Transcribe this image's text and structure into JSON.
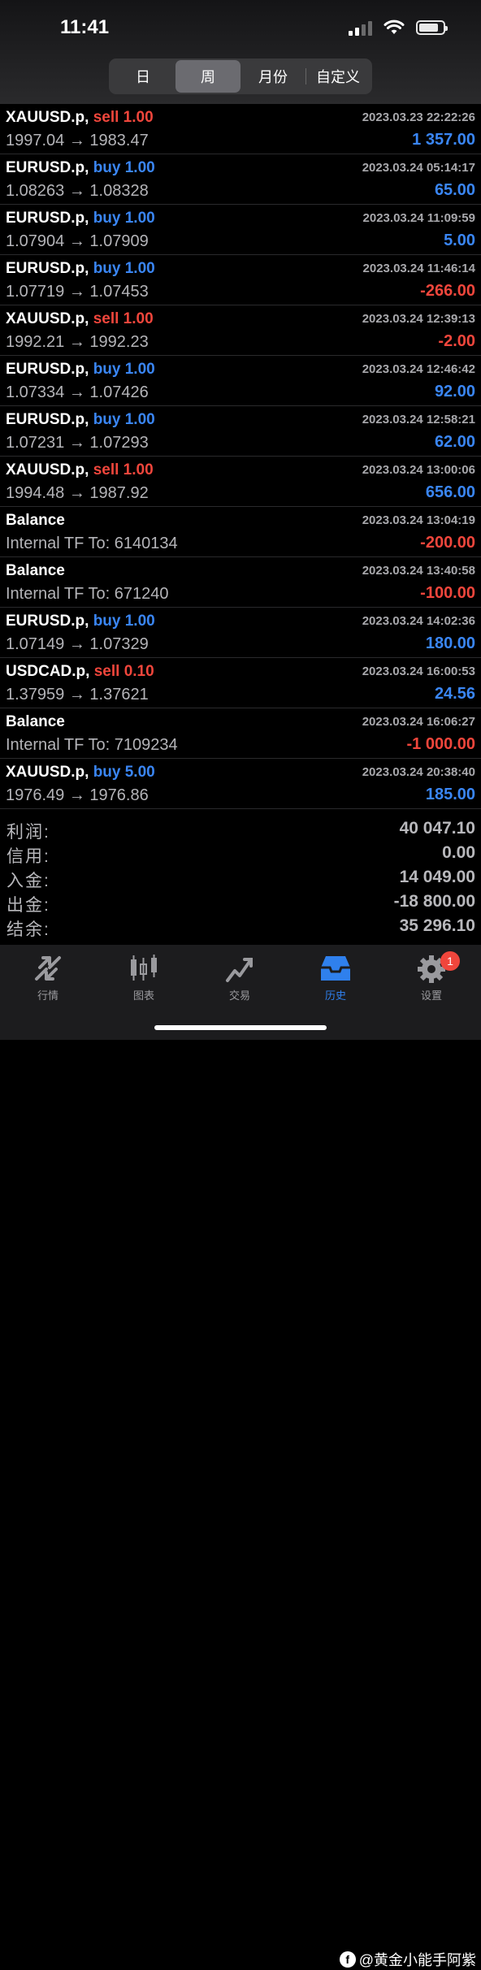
{
  "status": {
    "time": "11:41"
  },
  "tabs": [
    "日",
    "周",
    "月份",
    "自定义"
  ],
  "active_tab": "周",
  "trades": [
    {
      "symbol": "XAUUSD.p,",
      "side": "sell",
      "side_text": "sell 1.00",
      "prices": "1997.04 → 1983.47",
      "time": "2023.03.23 22:22:26",
      "profit": "1 357.00",
      "profit_sign": "pos"
    },
    {
      "symbol": "EURUSD.p,",
      "side": "buy",
      "side_text": "buy 1.00",
      "prices": "1.08263 → 1.08328",
      "time": "2023.03.24 05:14:17",
      "profit": "65.00",
      "profit_sign": "pos"
    },
    {
      "symbol": "EURUSD.p,",
      "side": "buy",
      "side_text": "buy 1.00",
      "prices": "1.07904 → 1.07909",
      "time": "2023.03.24 11:09:59",
      "profit": "5.00",
      "profit_sign": "pos"
    },
    {
      "symbol": "EURUSD.p,",
      "side": "buy",
      "side_text": "buy 1.00",
      "prices": "1.07719 → 1.07453",
      "time": "2023.03.24 11:46:14",
      "profit": "-266.00",
      "profit_sign": "neg"
    },
    {
      "symbol": "XAUUSD.p,",
      "side": "sell",
      "side_text": "sell 1.00",
      "prices": "1992.21 → 1992.23",
      "time": "2023.03.24 12:39:13",
      "profit": "-2.00",
      "profit_sign": "neg"
    },
    {
      "symbol": "EURUSD.p,",
      "side": "buy",
      "side_text": "buy 1.00",
      "prices": "1.07334 → 1.07426",
      "time": "2023.03.24 12:46:42",
      "profit": "92.00",
      "profit_sign": "pos"
    },
    {
      "symbol": "EURUSD.p,",
      "side": "buy",
      "side_text": "buy 1.00",
      "prices": "1.07231 → 1.07293",
      "time": "2023.03.24 12:58:21",
      "profit": "62.00",
      "profit_sign": "pos"
    },
    {
      "symbol": "XAUUSD.p,",
      "side": "sell",
      "side_text": "sell 1.00",
      "prices": "1994.48 → 1987.92",
      "time": "2023.03.24 13:00:06",
      "profit": "656.00",
      "profit_sign": "pos"
    },
    {
      "symbol": "Balance",
      "side": "",
      "side_text": "",
      "prices": "Internal TF To: 6140134",
      "time": "2023.03.24 13:04:19",
      "profit": "-200.00",
      "profit_sign": "neg"
    },
    {
      "symbol": "Balance",
      "side": "",
      "side_text": "",
      "prices": "Internal TF To: 671240",
      "time": "2023.03.24 13:40:58",
      "profit": "-100.00",
      "profit_sign": "neg"
    },
    {
      "symbol": "EURUSD.p,",
      "side": "buy",
      "side_text": "buy 1.00",
      "prices": "1.07149 → 1.07329",
      "time": "2023.03.24 14:02:36",
      "profit": "180.00",
      "profit_sign": "pos"
    },
    {
      "symbol": "USDCAD.p,",
      "side": "sell",
      "side_text": "sell 0.10",
      "prices": "1.37959 → 1.37621",
      "time": "2023.03.24 16:00:53",
      "profit": "24.56",
      "profit_sign": "pos"
    },
    {
      "symbol": "Balance",
      "side": "",
      "side_text": "",
      "prices": "Internal TF To: 7109234",
      "time": "2023.03.24 16:06:27",
      "profit": "-1 000.00",
      "profit_sign": "neg"
    },
    {
      "symbol": "XAUUSD.p,",
      "side": "buy",
      "side_text": "buy 5.00",
      "prices": "1976.49 → 1976.86",
      "time": "2023.03.24 20:38:40",
      "profit": "185.00",
      "profit_sign": "pos"
    }
  ],
  "summary": [
    {
      "label": "利润:",
      "value": "40 047.10"
    },
    {
      "label": "信用:",
      "value": "0.00"
    },
    {
      "label": "入金:",
      "value": "14 049.00"
    },
    {
      "label": "出金:",
      "value": "-18 800.00"
    },
    {
      "label": "结余:",
      "value": "35 296.10"
    }
  ],
  "tabbar": {
    "items": [
      {
        "label": "行情",
        "icon": "quotes-icon"
      },
      {
        "label": "图表",
        "icon": "chart-icon"
      },
      {
        "label": "交易",
        "icon": "trade-icon"
      },
      {
        "label": "历史",
        "icon": "history-icon"
      },
      {
        "label": "设置",
        "icon": "settings-icon"
      }
    ],
    "active": "历史",
    "badge": "1"
  },
  "watermark": "@黄金小能手阿紫",
  "colors": {
    "buy": "#3a86f5",
    "sell": "#f0463c",
    "active": "#2f80ed"
  }
}
